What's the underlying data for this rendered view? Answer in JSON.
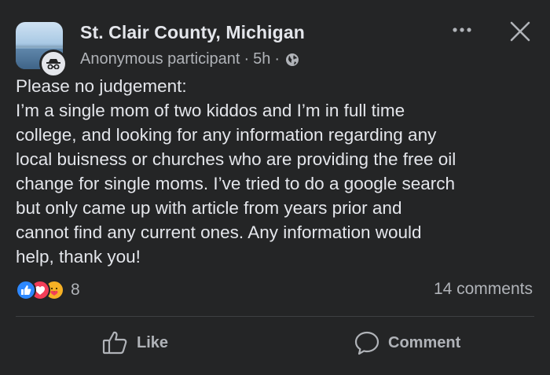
{
  "post": {
    "group_name": "St. Clair County, Michigan",
    "author": "Anonymous participant",
    "separator": "·",
    "time": "5h",
    "visibility_icon": "globe-icon",
    "body_lines": [
      "Please no judgement:",
      "I’m a single mom of two kiddos and I’m in full time",
      "college, and looking for any information regarding any",
      "local buisness or churches who are providing the free oil",
      "change for single moms. I’ve tried to do a google search",
      "but only came up with article from years prior and",
      "cannot find any current ones. Any information would",
      "help, thank you!"
    ]
  },
  "reactions": {
    "icons": [
      "like-reaction-icon",
      "love-reaction-icon",
      "care-reaction-icon"
    ],
    "count": "8"
  },
  "comments_count": "14 comments",
  "actions": {
    "like_label": "Like",
    "comment_label": "Comment"
  },
  "colors": {
    "background": "#242526",
    "primary_text": "#e4e6eb",
    "secondary_text": "#b0b3b8",
    "like_blue": "#2d88ff",
    "love_red": "#f33e58",
    "care_yellow": "#f7b125",
    "divider": "#3e4042"
  }
}
